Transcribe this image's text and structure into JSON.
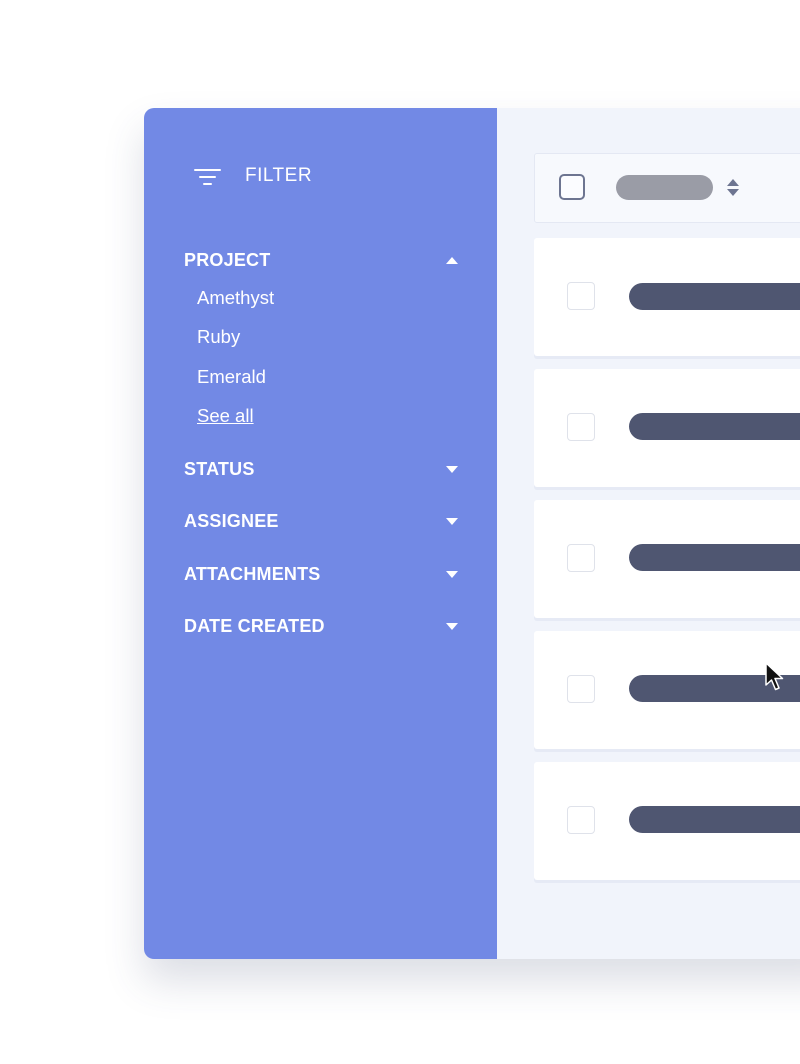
{
  "sidebar": {
    "filter_label": "FILTER",
    "sections": [
      {
        "title": "PROJECT",
        "expanded": true,
        "items": [
          "Amethyst",
          "Ruby",
          "Emerald"
        ],
        "see_all": "See all"
      },
      {
        "title": "STATUS",
        "expanded": false
      },
      {
        "title": "ASSIGNEE",
        "expanded": false
      },
      {
        "title": "ATTACHMENTS",
        "expanded": false
      },
      {
        "title": "DATE CREATED",
        "expanded": false
      }
    ]
  },
  "colors": {
    "sidebar_bg": "#7289e5",
    "main_bg": "#f1f4fb",
    "row_bar": "#4f5671",
    "header_pill": "#9a9ca6"
  },
  "icons": {
    "filter": "filter-icon",
    "sort": "sort-icon",
    "caret_up": "caret-up-icon",
    "caret_down": "caret-down-icon",
    "cursor": "mouse-pointer"
  }
}
